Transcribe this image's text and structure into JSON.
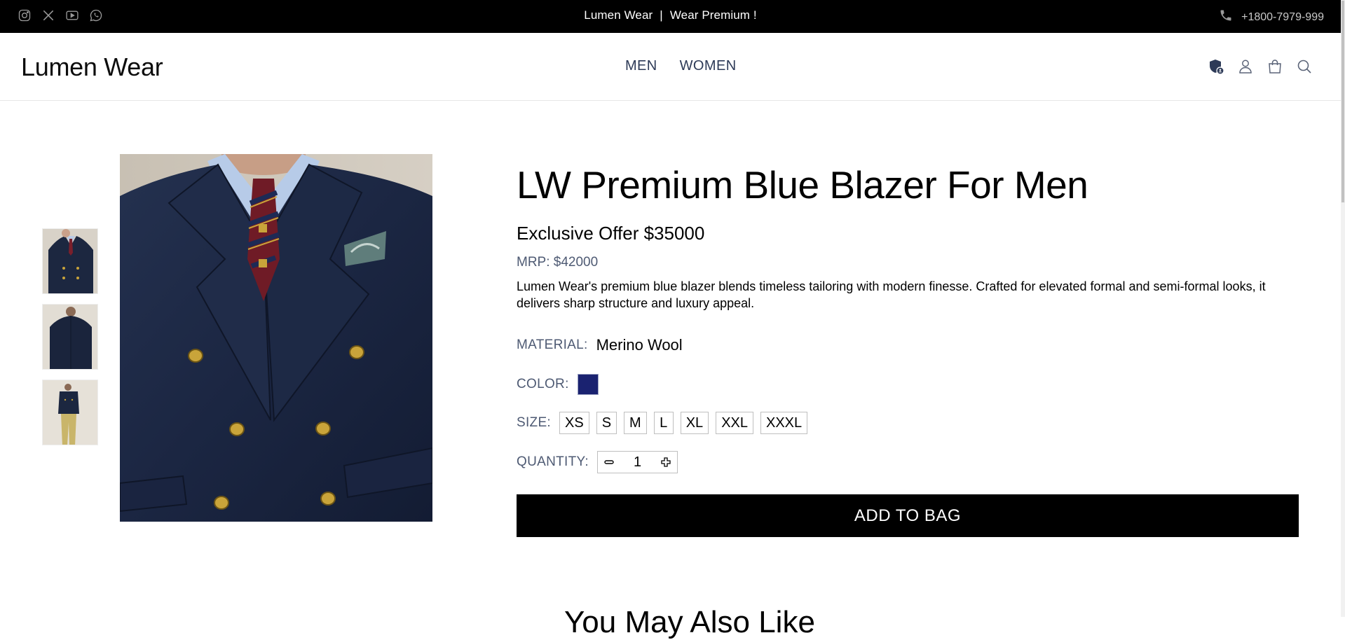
{
  "topbar": {
    "social_icons": [
      "instagram-icon",
      "x-icon",
      "youtube-icon",
      "whatsapp-icon"
    ],
    "brand": "Lumen Wear",
    "separator": "|",
    "tagline": "Wear Premium !",
    "phone": "+1800-7979-999"
  },
  "header": {
    "logo": "Lumen Wear",
    "nav": [
      "MEN",
      "WOMEN"
    ],
    "icons": [
      "shield-user-icon",
      "user-icon",
      "bag-icon",
      "search-icon"
    ]
  },
  "product": {
    "title": "LW Premium Blue Blazer For Men",
    "offer": "Exclusive Offer $35000",
    "mrp": "MRP: $42000",
    "description": "Lumen Wear's premium blue blazer blends timeless tailoring with modern finesse. Crafted for elevated formal and semi-formal looks, it delivers sharp structure and luxury appeal.",
    "material_label": "MATERIAL:",
    "material_value": "Merino Wool",
    "color_label": "COLOR:",
    "color_value": "#1a2270",
    "size_label": "SIZE:",
    "sizes": [
      "XS",
      "S",
      "M",
      "L",
      "XL",
      "XXL",
      "XXXL"
    ],
    "quantity_label": "QUANTITY:",
    "quantity": "1",
    "add_to_bag": "ADD TO BAG"
  },
  "recommendations": {
    "heading": "You May Also Like"
  },
  "colors": {
    "topbar_bg": "#000000",
    "nav_text": "#2d3a57",
    "label_text": "#4e5a73",
    "button_bg": "#000000"
  }
}
